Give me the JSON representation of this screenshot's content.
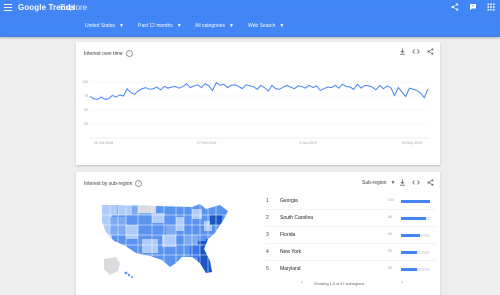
{
  "header": {
    "logo": "Google Trends",
    "section": "Explore",
    "icons": [
      "menu-icon",
      "share-icon",
      "feedback-icon",
      "apps-icon"
    ]
  },
  "filters": {
    "region": "United States",
    "period": "Past 12 months",
    "category": "All categories",
    "search_type": "Web Search"
  },
  "interest_over_time": {
    "title": "Interest over time",
    "icons": [
      "download-icon",
      "embed-icon",
      "share-icon"
    ],
    "chart_data": {
      "type": "line",
      "ylim": [
        0,
        100
      ],
      "yticks": [
        "100",
        "75",
        "50",
        "25"
      ],
      "xticks": [
        "26 Oct 2018",
        "17 Feb 2019",
        "9 Jun 2019",
        "29 Sep 2019"
      ],
      "values": [
        74,
        70,
        69,
        73,
        69,
        70,
        76,
        73,
        77,
        75,
        88,
        81,
        78,
        84,
        88,
        90,
        87,
        88,
        91,
        86,
        92,
        89,
        91,
        92,
        89,
        92,
        97,
        90,
        93,
        95,
        90,
        97,
        93,
        85,
        99,
        94,
        96,
        90,
        94,
        95,
        92,
        88,
        95,
        93,
        92,
        87,
        94,
        90,
        84,
        94,
        88,
        87,
        91,
        94,
        91,
        88,
        93,
        92,
        89,
        94,
        90,
        93,
        85,
        88,
        91,
        90,
        94,
        89,
        96,
        92,
        91,
        87,
        96,
        89,
        94,
        93,
        91,
        86,
        94,
        88,
        93,
        90,
        76,
        90,
        82,
        74,
        89,
        87,
        85,
        80,
        72,
        88
      ]
    }
  },
  "interest_by_subregion": {
    "title": "Interest by sub-region",
    "selector": "Sub-region",
    "icons": [
      "download-icon",
      "embed-icon",
      "share-icon"
    ],
    "rows": [
      {
        "rank": "1",
        "name": "Georgia",
        "value": "100",
        "fraction": 1.0
      },
      {
        "rank": "2",
        "name": "South Carolina",
        "value": "86",
        "fraction": 0.86
      },
      {
        "rank": "3",
        "name": "Florida",
        "value": "65",
        "fraction": 0.65
      },
      {
        "rank": "4",
        "name": "New York",
        "value": "55",
        "fraction": 0.55
      },
      {
        "rank": "5",
        "name": "Maryland",
        "value": "55",
        "fraction": 0.55
      }
    ],
    "pagination": "Showing 1-5 of 47 subregions"
  },
  "colors": {
    "brand_blue": "#4285f4",
    "map_light": "#aecbfa",
    "map_mid": "#5b94f0",
    "map_dark": "#1a56c4",
    "map_none": "#dadce0"
  }
}
